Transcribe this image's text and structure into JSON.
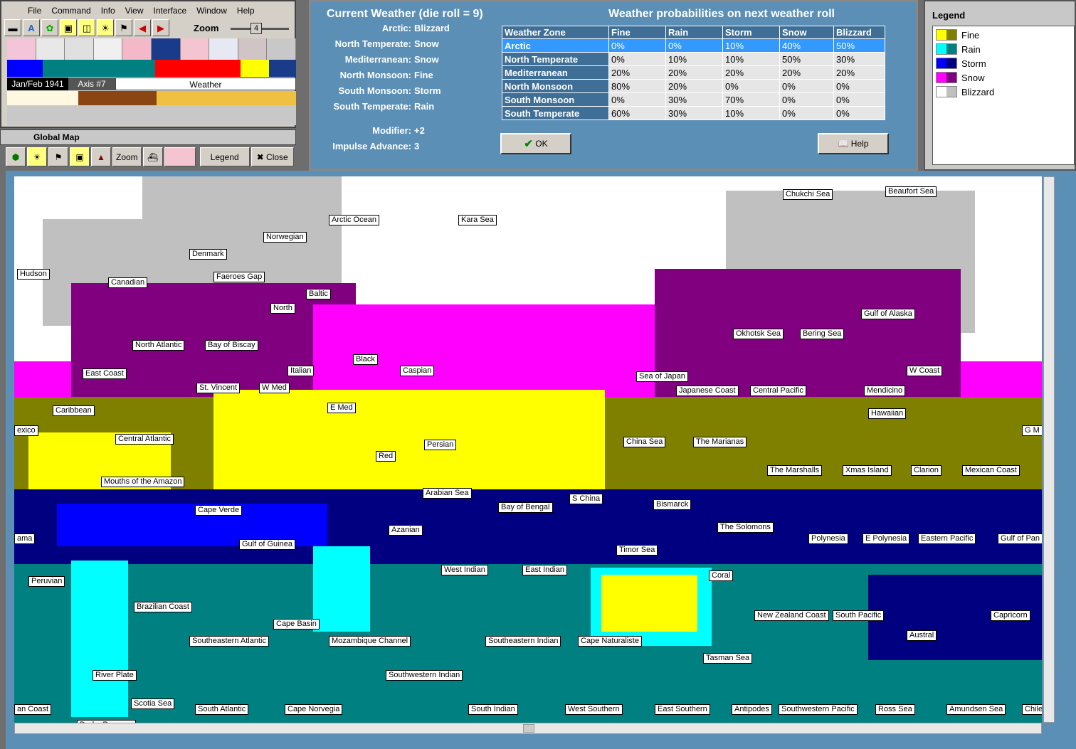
{
  "menu": [
    "File",
    "Command",
    "Info",
    "View",
    "Interface",
    "Window",
    "Help"
  ],
  "toolbar": {
    "zoom_label": "Zoom",
    "zoom_value": "4"
  },
  "status": {
    "date": "Jan/Feb 1941",
    "axis": "Axis #7",
    "mode": "Weather"
  },
  "global_map": {
    "title": "Global Map",
    "zoom_btn": "Zoom",
    "legend_btn": "Legend",
    "close_btn": "Close"
  },
  "weather": {
    "title": "Current Weather (die roll = 9)",
    "prob_title": "Weather probabilities on next weather roll",
    "zones": [
      {
        "k": "Arctic:",
        "v": "Blizzard"
      },
      {
        "k": "North Temperate:",
        "v": "Snow"
      },
      {
        "k": "Mediterranean:",
        "v": "Snow"
      },
      {
        "k": "North Monsoon:",
        "v": "Fine"
      },
      {
        "k": "South Monsoon:",
        "v": "Storm"
      },
      {
        "k": "South Temperate:",
        "v": "Rain"
      }
    ],
    "modifier": {
      "k": "Modifier:",
      "v": "+2"
    },
    "impulse": {
      "k": "Impulse Advance:",
      "v": "3"
    },
    "headers": [
      "Weather Zone",
      "Fine",
      "Rain",
      "Storm",
      "Snow",
      "Blizzard"
    ],
    "rows": [
      [
        "Arctic",
        "0%",
        "0%",
        "10%",
        "40%",
        "50%"
      ],
      [
        "North Temperate",
        "0%",
        "10%",
        "10%",
        "50%",
        "30%"
      ],
      [
        "Mediterranean",
        "20%",
        "20%",
        "20%",
        "20%",
        "20%"
      ],
      [
        "North Monsoon",
        "80%",
        "20%",
        "0%",
        "0%",
        "0%"
      ],
      [
        "South Monsoon",
        "0%",
        "30%",
        "70%",
        "0%",
        "0%"
      ],
      [
        "South Temperate",
        "60%",
        "30%",
        "10%",
        "0%",
        "0%"
      ]
    ],
    "ok": "OK",
    "help": "Help"
  },
  "legend": {
    "title": "Legend",
    "items": [
      {
        "label": "Fine",
        "c1": "#ffff00",
        "c2": "#808000"
      },
      {
        "label": "Rain",
        "c1": "#00ffff",
        "c2": "#008080"
      },
      {
        "label": "Storm",
        "c1": "#0000ff",
        "c2": "#000080"
      },
      {
        "label": "Snow",
        "c1": "#ff00ff",
        "c2": "#800080"
      },
      {
        "label": "Blizzard",
        "c1": "#ffffff",
        "c2": "#c0c0c0"
      }
    ]
  },
  "map_labels": [
    "Chukchi Sea",
    "Beaufort Sea",
    "Arctic Ocean",
    "Kara Sea",
    "Norwegian",
    "Denmark",
    "Hudson",
    "Canadian",
    "Faeroes Gap",
    "Baltic",
    "North",
    "Gulf of Alaska",
    "Okhotsk Sea",
    "Bering Sea",
    "North Atlantic",
    "Bay of Biscay",
    "Black",
    "Caspian",
    "East Coast",
    "Italian",
    "St. Vincent",
    "W Med",
    "Sea of Japan",
    "Japanese Coast",
    "Central Pacific",
    "Mendicino",
    "W Coast",
    "Caribbean",
    "E Med",
    "Hawaiian",
    "exico",
    "Central Atlantic",
    "Persian",
    "China Sea",
    "The Marianas",
    "G M",
    "Red",
    "Mouths of the Amazon",
    "The Marshalls",
    "Xmas Island",
    "Clarion",
    "Mexican Coast",
    "Arabian Sea",
    "S China",
    "Cape Verde",
    "Bay of Bengal",
    "Bismarck",
    "The Solomons",
    "Azanian",
    "ama",
    "Gulf of Guinea",
    "Polynesia",
    "E Polynesia",
    "Eastern Pacific",
    "Gulf of Pan",
    "Timor Sea",
    "West Indian",
    "East Indian",
    "Coral",
    "Peruvian",
    "Brazilian Coast",
    "New Zealand Coast",
    "South Pacific",
    "Capricorn",
    "Cape Basin",
    "Austral",
    "Southeastern Atlantic",
    "Mozambique Channel",
    "Southeastern Indian",
    "Cape Naturaliste",
    "Tasman Sea",
    "Southwestern Indian",
    "River Plate",
    "Scotia Sea",
    "an Coast",
    "South Atlantic",
    "Cape Norvegia",
    "South Indian",
    "West Southern",
    "East Southern",
    "Antipodes",
    "Southwestern Pacific",
    "Ross Sea",
    "Amundsen Sea",
    "Chile",
    "Drake Passage"
  ]
}
